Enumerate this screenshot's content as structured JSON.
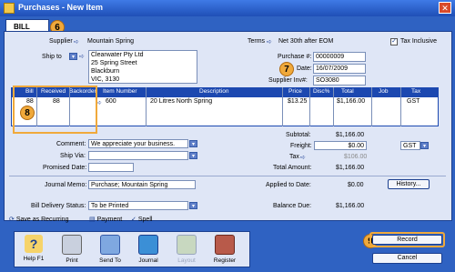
{
  "window": {
    "title": "Purchases - New Item",
    "close": "✕"
  },
  "tab": {
    "label": "BILL"
  },
  "badges": {
    "b6": "6",
    "b7": "7",
    "b8": "8",
    "b9": "9"
  },
  "supplier": {
    "label": "Supplier",
    "value": "Mountain Spring"
  },
  "terms": {
    "label": "Terms",
    "value": "Net 30th after EOM"
  },
  "tax_inclusive": {
    "label": "Tax Inclusive",
    "checked": "✓"
  },
  "ship_to": {
    "label": "Ship to",
    "lines": [
      "Clearwater Pty Ltd",
      "25 Spring Street",
      "Blackburn",
      "VIC, 3130"
    ]
  },
  "purchase_no": {
    "label": "Purchase #:",
    "value": "00000009"
  },
  "date": {
    "label": "Date:",
    "value": "16/07/2009"
  },
  "supplier_inv": {
    "label": "Supplier Inv#:",
    "value": "SO3080"
  },
  "grid": {
    "headers": [
      "Bill",
      "Received",
      "Backorder",
      "Item Number",
      "Description",
      "Price",
      "Disc%",
      "Total",
      "Job",
      "Tax"
    ],
    "row": {
      "bill": "88",
      "received": "88",
      "backorder": "",
      "item": "600",
      "description": "20 Litres North Spring",
      "price": "$13.25",
      "disc": "",
      "total": "$1,166.00",
      "job": "",
      "tax": "GST"
    }
  },
  "comment": {
    "label": "Comment:",
    "value": "We appreciate your business."
  },
  "ship_via": {
    "label": "Ship Via:",
    "value": ""
  },
  "promised_date": {
    "label": "Promised Date:",
    "value": ""
  },
  "totals": {
    "subtotal_label": "Subtotal:",
    "subtotal": "$1,166.00",
    "freight_label": "Freight:",
    "freight": "$0.00",
    "tax_label": "Tax",
    "tax": "$106.00",
    "total_label": "Total Amount:",
    "total": "$1,166.00",
    "freight_tax": "GST"
  },
  "journal_memo": {
    "label": "Journal Memo:",
    "value": "Purchase; Mountain Spring"
  },
  "applied": {
    "label": "Applied to Date:",
    "value": "$0.00"
  },
  "history_btn": "History...",
  "delivery": {
    "label": "Bill Delivery Status:",
    "value": "To be Printed"
  },
  "balance": {
    "label": "Balance Due:",
    "value": "$1,166.00"
  },
  "sub_buttons": {
    "recurring": "Save as Recurring",
    "payment": "Payment",
    "spell": "Spell"
  },
  "toolbar": {
    "help": "Help F1",
    "print": "Print",
    "send": "Send To",
    "journal": "Journal",
    "layout": "Layout",
    "register": "Register"
  },
  "buttons": {
    "record": "Record",
    "cancel": "Cancel"
  }
}
